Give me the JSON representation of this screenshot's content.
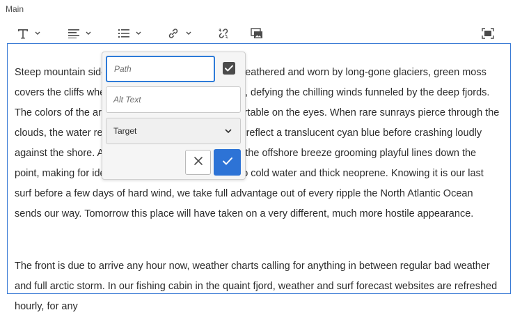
{
  "section": {
    "label": "Main"
  },
  "toolbar": {
    "items": [
      {
        "name": "paragraph-format",
        "icon": "text-format-icon",
        "has_dropdown": true
      },
      {
        "name": "alignment",
        "icon": "align-icon",
        "has_dropdown": true
      },
      {
        "name": "list",
        "icon": "list-icon",
        "has_dropdown": true
      },
      {
        "name": "link",
        "icon": "link-icon",
        "has_dropdown": true
      },
      {
        "name": "unlink",
        "icon": "unlink-icon",
        "has_dropdown": false
      },
      {
        "name": "image",
        "icon": "image-icon",
        "has_dropdown": false
      },
      {
        "name": "fullscreen",
        "icon": "fullscreen-icon",
        "has_dropdown": false
      }
    ]
  },
  "link_dialog": {
    "path_placeholder": "Path",
    "path_value": "",
    "alt_placeholder": "Alt Text",
    "alt_value": "",
    "target_label": "Target",
    "checkbox_checked": true,
    "accent_color": "#2d73d6"
  },
  "editor": {
    "paragraphs": [
      "Steep mountain sides rise from a distant timeline, weathered and worn by long-gone glaciers, green moss covers the cliffs where sheep forage on steep grass, defying the chilling winds funneled by the deep fjords. The colors of the arctic circle are welcoming, comfortable on the eyes. When rare sunrays pierce through the clouds, the water reveals its vibrancy, as the waves reflect a translucent cyan blue before crashing loudly against the shore. A playful groundswell is building, the offshore breeze grooming playful lines down the point, making for ideal conditions for acclimatizing to cold water and thick neoprene. Knowing it is our last surf before a few days of hard wind, we take full advantage out of every ripple the North Atlantic Ocean sends our way. Tomorrow this place will have taken on a very different, much more hostile appearance.",
      "The front is due to arrive any hour now, weather charts calling for anything in between regular bad weather and full arctic storm. In our fishing cabin in the quaint fjord, weather and surf forecast websites are refreshed hourly, for any"
    ]
  }
}
